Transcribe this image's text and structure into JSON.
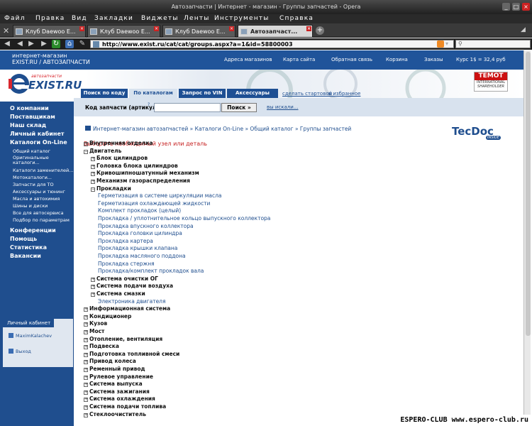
{
  "window": {
    "title": "Автозапчасти | Интернет - магазин - Группы запчастей - Opera"
  },
  "menubar": [
    "Файл",
    "Правка",
    "Вид",
    "Закладки",
    "Виджеты",
    "Ленты",
    "Инструменты",
    "Справка"
  ],
  "tabs": [
    {
      "label": "Клуб Daewoo E..."
    },
    {
      "label": "Клуб Daewoo E..."
    },
    {
      "label": "Клуб Daewoo E..."
    },
    {
      "label": "Автозапчаст..."
    }
  ],
  "address": {
    "url": "http://www.exist.ru/cat/cat/groups.aspx?a=1&id=58800003"
  },
  "site": {
    "brand_line1": "интернет-магазин",
    "brand_line2": "EXIST.RU / АВТОЗАПЧАСТИ",
    "toplinks": [
      "Адреса магазинов",
      "Карта сайта",
      "Обратная связь",
      "Корзина",
      "Заказы",
      "Курс 1$ = 32,4 руб"
    ],
    "logo_small": "автозапчасти",
    "logo_big": "EXIST.RU",
    "temot": [
      "TEMOT",
      "INTERNATIONAL",
      "SHAREHOLDER"
    ],
    "nav_tabs": [
      "Поиск по коду",
      "По каталогам",
      "Запрос по VIN",
      "Аксессуары"
    ],
    "nav_links": [
      "сделать стартовой",
      "в избранное"
    ],
    "search_label": "Код запчасти (артикул):",
    "search_hint": "?",
    "search_button": "Поиск »",
    "search_link": "вы искали...",
    "breadcrumb": "Интернет-магазин автозапчастей » Каталоги On-Line » Общий каталог » Группы запчастей",
    "tecdoc": "TecDoc",
    "tecdoc_sub": "INSIDE",
    "prompt": "Выберите необходимый узел или деталь",
    "left_menu": [
      "О компании",
      "Поставщикам",
      "Наш склад",
      "Личный кабинет",
      "Каталоги On-Line"
    ],
    "catalog_sub": [
      "Общий каталог",
      "Оригинальные каталоги...",
      "Каталоги заменителей...",
      "Мотокаталоги...",
      "Запчасти для ТО",
      "Аксессуары и тюнинг",
      "Масла и автохимия",
      "Шины и диски",
      "Все для автосервиса",
      "Подбор по параметрам"
    ],
    "left_menu2": [
      "Конференции",
      "Помощь",
      "Статистика",
      "Вакансии"
    ],
    "cabinet_title": "Личный кабинет",
    "cabinet_user": "MaximKalachev",
    "cabinet_exit": "Выход"
  },
  "tree": [
    {
      "t": "Внутренняя отделка",
      "lvl": 0,
      "s": "+"
    },
    {
      "t": "Двигатель",
      "lvl": 0,
      "s": "-"
    },
    {
      "t": "Блок цилиндров",
      "lvl": 1,
      "s": "+"
    },
    {
      "t": "Головка блока цилиндров",
      "lvl": 1,
      "s": "+"
    },
    {
      "t": "Кривошипношатунный механизм",
      "lvl": 1,
      "s": "+"
    },
    {
      "t": "Механизм газораспределения",
      "lvl": 1,
      "s": "+"
    },
    {
      "t": "Прокладки",
      "lvl": 1,
      "s": "-"
    },
    {
      "t": "Герметизация в системе циркуляции масла",
      "lvl": 2,
      "s": ""
    },
    {
      "t": "Герметизация охлаждающей жидкости",
      "lvl": 2,
      "s": ""
    },
    {
      "t": "Комплект прокладок (целый)",
      "lvl": 2,
      "s": ""
    },
    {
      "t": "Прокладка / уплотнительное кольцо выпускного коллектора",
      "lvl": 2,
      "s": ""
    },
    {
      "t": "Прокладка впускного коллектора",
      "lvl": 2,
      "s": ""
    },
    {
      "t": "Прокладка головки цилиндра",
      "lvl": 2,
      "s": ""
    },
    {
      "t": "Прокладка картера",
      "lvl": 2,
      "s": ""
    },
    {
      "t": "Прокладка крышки клапана",
      "lvl": 2,
      "s": ""
    },
    {
      "t": "Прокладка масляного поддона",
      "lvl": 2,
      "s": ""
    },
    {
      "t": "Прокладка стержня",
      "lvl": 2,
      "s": ""
    },
    {
      "t": "Прокладка/комплект прокладок вала",
      "lvl": 2,
      "s": ""
    },
    {
      "t": "Система очистки ОГ",
      "lvl": 1,
      "s": "+"
    },
    {
      "t": "Система подачи воздуха",
      "lvl": 1,
      "s": "+"
    },
    {
      "t": "Система смазки",
      "lvl": 1,
      "s": "+"
    },
    {
      "t": "Электроника двигателя",
      "lvl": 2,
      "s": ""
    },
    {
      "t": "Информационная система",
      "lvl": 0,
      "s": "+"
    },
    {
      "t": "Кондиционер",
      "lvl": 0,
      "s": "+"
    },
    {
      "t": "Кузов",
      "lvl": 0,
      "s": "+"
    },
    {
      "t": "Мост",
      "lvl": 0,
      "s": "+"
    },
    {
      "t": "Отопление, вентиляция",
      "lvl": 0,
      "s": "+"
    },
    {
      "t": "Подвеска",
      "lvl": 0,
      "s": "+"
    },
    {
      "t": "Подготовка топливной смеси",
      "lvl": 0,
      "s": "+"
    },
    {
      "t": "Привод колеса",
      "lvl": 0,
      "s": "+"
    },
    {
      "t": "Ременный привод",
      "lvl": 0,
      "s": "+"
    },
    {
      "t": "Рулевое управление",
      "lvl": 0,
      "s": "+"
    },
    {
      "t": "Система выпуска",
      "lvl": 0,
      "s": "+"
    },
    {
      "t": "Система зажигания",
      "lvl": 0,
      "s": "+"
    },
    {
      "t": "Система охлаждения",
      "lvl": 0,
      "s": "+"
    },
    {
      "t": "Система подачи топлива",
      "lvl": 0,
      "s": "+"
    },
    {
      "t": "Стеклоочиститель",
      "lvl": 0,
      "s": "+"
    }
  ],
  "watermark": "ESPERO-CLUB www.espero-club.ru"
}
